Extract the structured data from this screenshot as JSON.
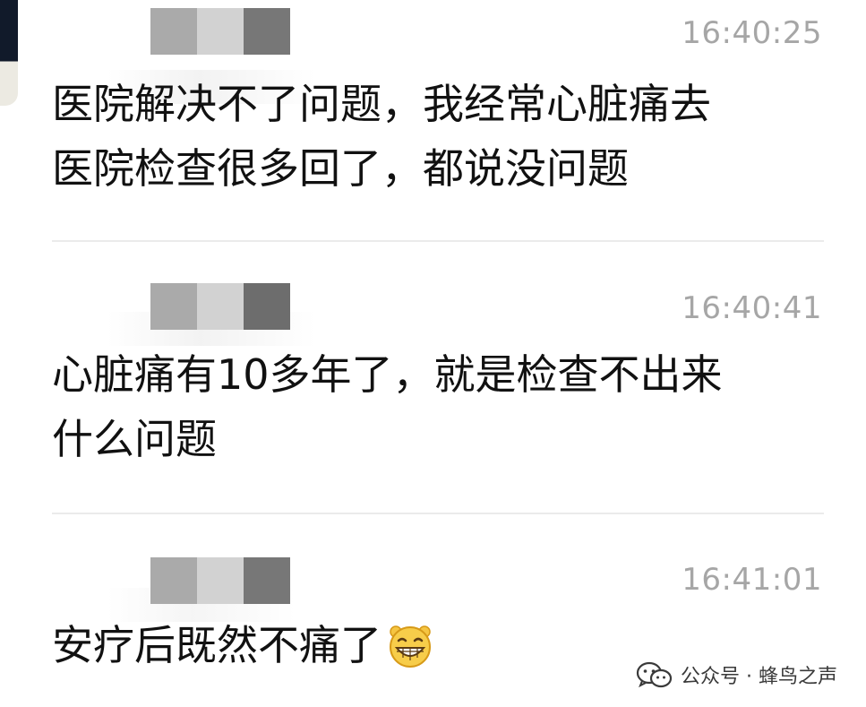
{
  "messages": [
    {
      "timestamp": "16:40:25",
      "lines": [
        "医院解决不了问题，我经常心脏痛去",
        "医院检查很多回了，都说没问题"
      ]
    },
    {
      "timestamp": "16:40:41",
      "lines": [
        "心脏痛有10多年了，就是检查不出来",
        "什么问题"
      ]
    },
    {
      "timestamp": "16:41:01",
      "lines": [
        "安疗后既然不痛了"
      ],
      "emoji": "grinning-face-emoji"
    }
  ],
  "watermark": {
    "icon": "wechat-official-account-icon",
    "text": "公众号 · 蜂鸟之声"
  },
  "colors": {
    "timestamp": "#a6a6a6",
    "text": "#111111",
    "divider": "#ebebeb",
    "emoji": "#f5c542"
  }
}
